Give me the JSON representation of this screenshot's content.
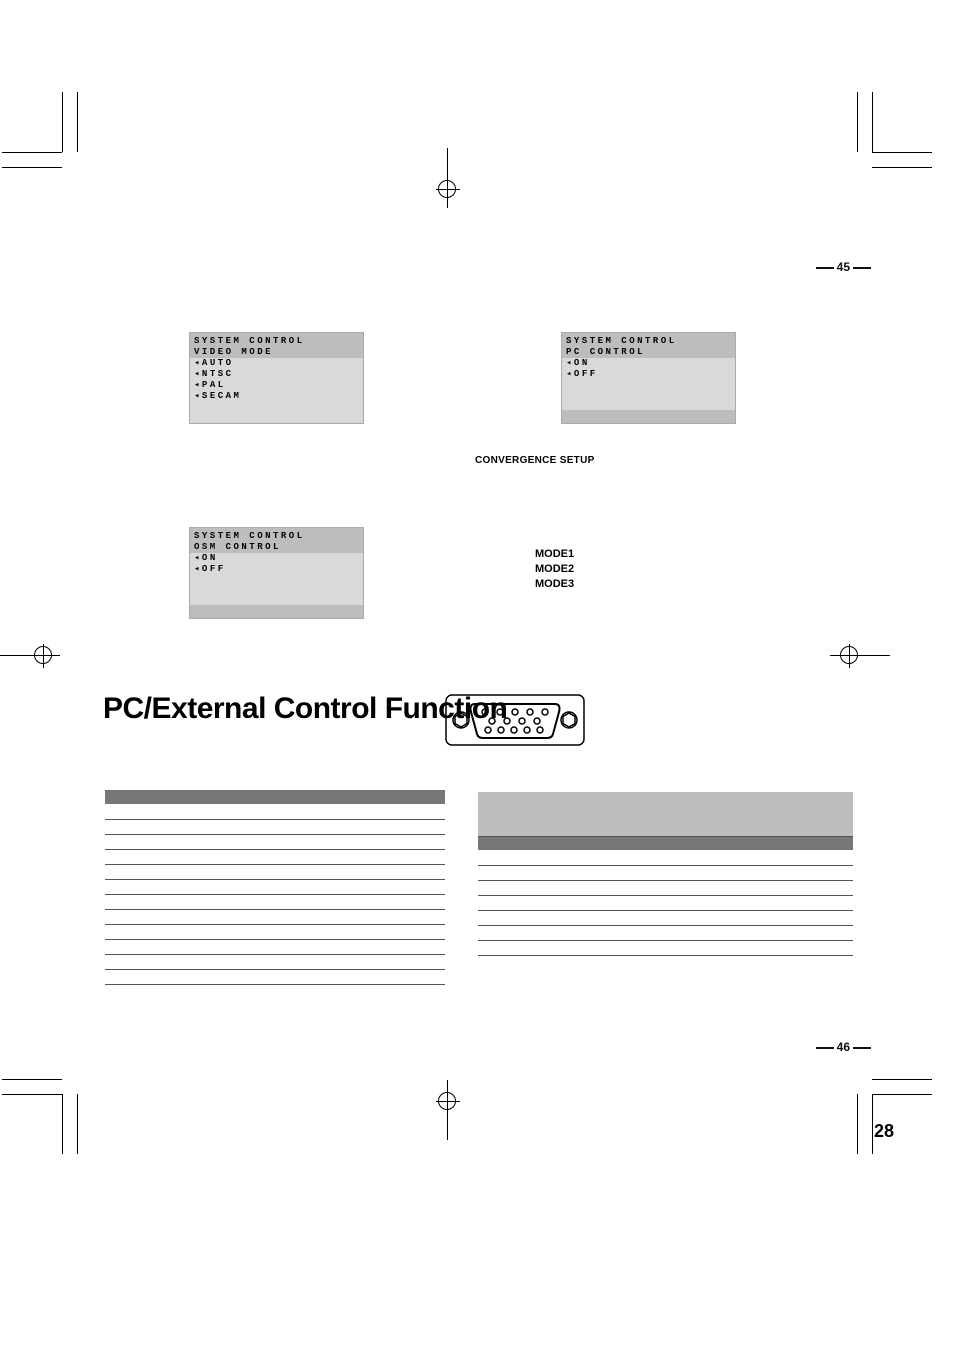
{
  "page_code_top": "45",
  "page_code_bottom": "46",
  "page_number": "28",
  "osd1": {
    "title": "SYSTEM CONTROL",
    "subtitle": "VIDEO MODE",
    "items": [
      "◂AUTO",
      "◂NTSC",
      "◂PAL",
      "◂SECAM"
    ]
  },
  "osd2": {
    "title": "SYSTEM CONTROL",
    "subtitle": "PC CONTROL",
    "items": [
      "◂ON",
      "◂OFF"
    ]
  },
  "osd3": {
    "title": "SYSTEM CONTROL",
    "subtitle": "OSM CONTROL",
    "items": [
      "◂ON",
      "◂OFF"
    ]
  },
  "convergence_heading": "CONVERGENCE SETUP",
  "modes": [
    "MODE1",
    "MODE2",
    "MODE3"
  ],
  "section_title": "PC/External Control Function",
  "table1": {
    "cols": 3,
    "rows": 12
  },
  "table2": {
    "cols": 5,
    "header_rows": 1,
    "rows": 7
  }
}
